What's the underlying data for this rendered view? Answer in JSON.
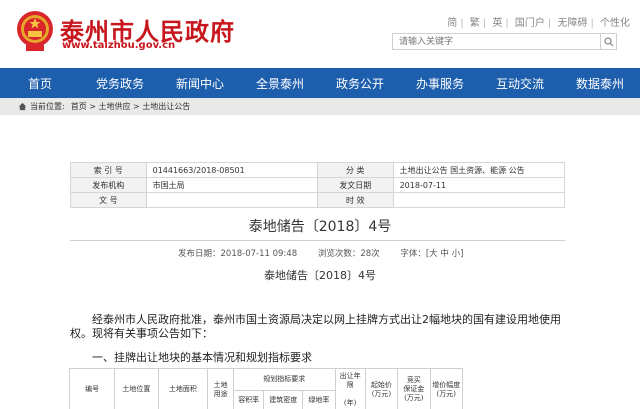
{
  "header": {
    "title": "泰州市人民政府",
    "domain": "www.taizhou.gov.cn",
    "toplinks": [
      "简",
      "繁",
      "英",
      "国门户",
      "无障碍",
      "个性化"
    ],
    "search_placeholder": "请输入关键字"
  },
  "nav": {
    "items": [
      "首页",
      "党务政务",
      "新闻中心",
      "全景泰州",
      "政务公开",
      "办事服务",
      "互动交流",
      "数据泰州"
    ]
  },
  "breadcrumb": {
    "label": "当前位置:",
    "path": "首页 > 土地供应 > 土地出让公告"
  },
  "info": {
    "index_label": "索 引 号",
    "index_value": "01441663/2018-08501",
    "category_label": "分 类",
    "category_value": "土地出让公告 国土资源、能源 公告",
    "issuer_label": "发布机构",
    "issuer_value": "市国土局",
    "issue_date_label": "发文日期",
    "issue_date_value": "2018-07-11",
    "docno_label": "文 号",
    "docno_value": "",
    "validity_label": "时 效",
    "validity_value": ""
  },
  "article": {
    "title": "泰地储告〔2018〕4号",
    "publish_time": "发布日期：2018-07-11 09:48",
    "views": "浏览次数：28次",
    "font_size": "字体：[大 中 小]",
    "subtitle": "泰地储告〔2018〕4号",
    "paragraph": "经泰州市人民政府批准，泰州市国土资源局决定以网上挂牌方式出让2幅地块的国有建设用地使用权。现将有关事项公告如下：",
    "section_heading": "一、挂牌出让地块的基本情况和规划指标要求"
  },
  "land_table": {
    "col_no": "编号",
    "col_location": "土地位置",
    "col_area": "土地面积",
    "col_use_top": "土地",
    "col_use_bottom": "用途",
    "col_plan": "规划指标要求",
    "col_far": "容积率",
    "col_density": "建筑密度",
    "col_green": "绿地率",
    "col_years_top": "出让年限",
    "col_years_bottom": "(年)",
    "col_start": "起始价(万元)",
    "col_deposit_top": "竞买",
    "col_deposit_bottom": "保证金(万元)",
    "col_increment": "增价幅度(万元)"
  },
  "colors": {
    "brand_red": "#c8161d",
    "nav_blue": "#1e5fad"
  }
}
